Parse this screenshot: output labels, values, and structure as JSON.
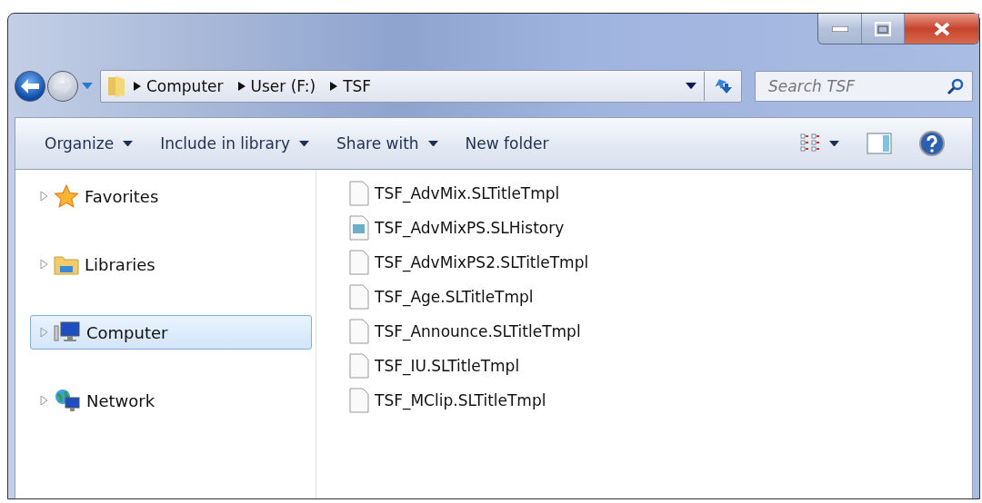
{
  "address_bar": {
    "crumbs": [
      "Computer",
      "User (F:)",
      "TSF"
    ]
  },
  "search": {
    "placeholder": "Search TSF"
  },
  "toolbar": {
    "buttons": [
      {
        "label": "Organize",
        "dropdown": true
      },
      {
        "label": "Include in library",
        "dropdown": true
      },
      {
        "label": "Share with",
        "dropdown": true
      },
      {
        "label": "New folder",
        "dropdown": false
      }
    ]
  },
  "sidebar": {
    "items": [
      {
        "label": "Favorites",
        "kind": "star",
        "selected": false
      },
      {
        "label": "Libraries",
        "kind": "library",
        "selected": false
      },
      {
        "label": "Computer",
        "kind": "computer",
        "selected": true
      },
      {
        "label": "Network",
        "kind": "network",
        "selected": false
      }
    ]
  },
  "files": [
    {
      "name": "TSF_AdvMix.SLTitleTmpl",
      "kind": "blank"
    },
    {
      "name": "TSF_AdvMixPS.SLHistory",
      "kind": "history"
    },
    {
      "name": "TSF_AdvMixPS2.SLTitleTmpl",
      "kind": "blank"
    },
    {
      "name": "TSF_Age.SLTitleTmpl",
      "kind": "blank"
    },
    {
      "name": "TSF_Announce.SLTitleTmpl",
      "kind": "blank"
    },
    {
      "name": "TSF_IU.SLTitleTmpl",
      "kind": "blank"
    },
    {
      "name": "TSF_MClip.SLTitleTmpl",
      "kind": "blank"
    }
  ]
}
